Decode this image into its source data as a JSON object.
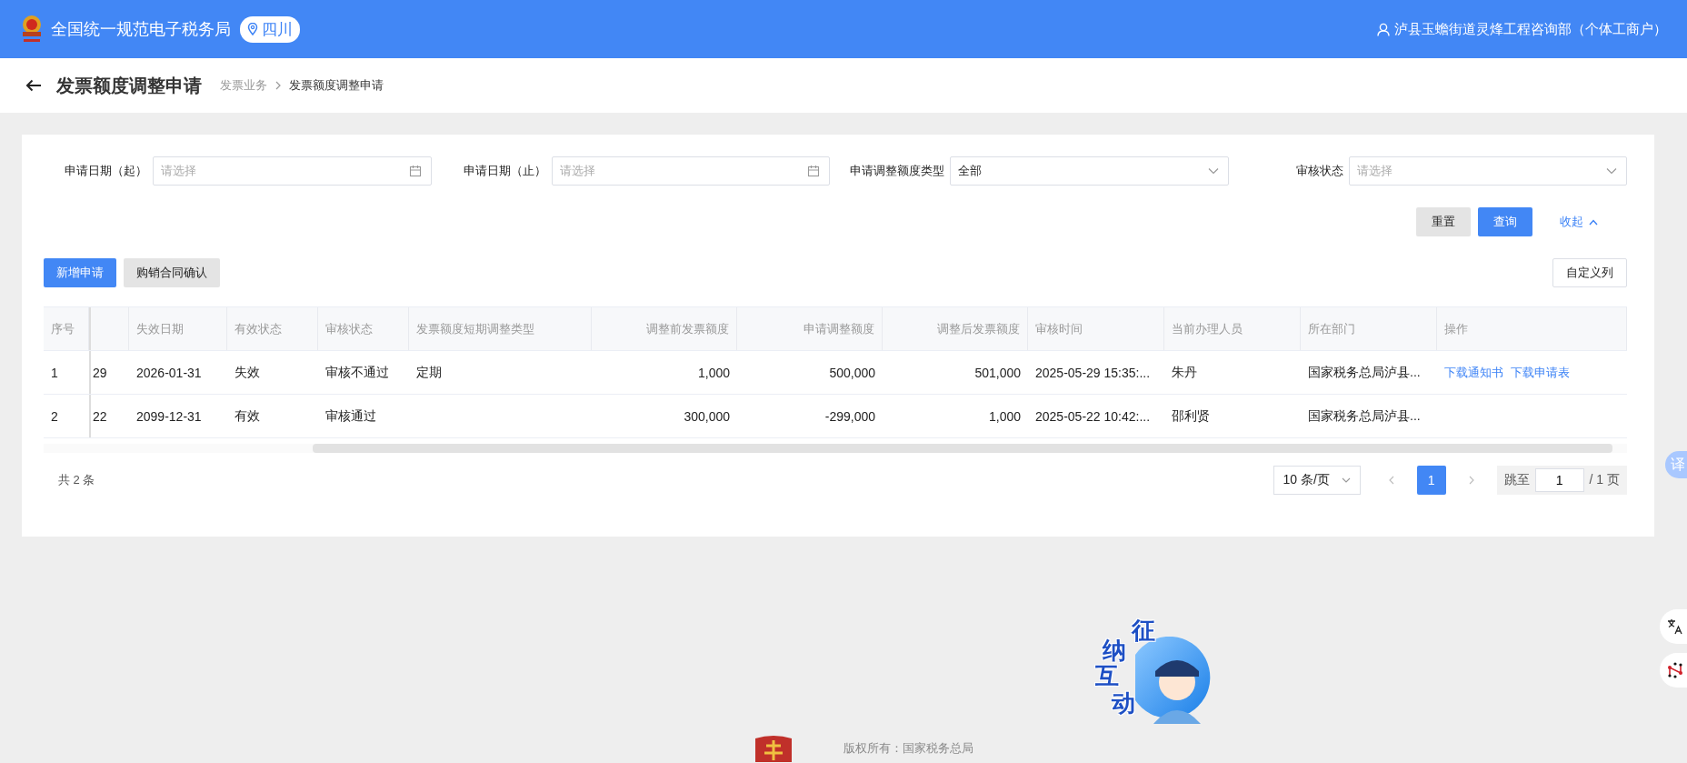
{
  "header": {
    "title": "全国统一规范电子税务局",
    "region": "四川",
    "user": "泸县玉蟾街道灵烽工程咨询部（个体工商户）"
  },
  "page": {
    "title": "发票额度调整申请",
    "breadcrumb": [
      {
        "label": "发票业务",
        "current": false
      },
      {
        "label": "发票额度调整申请",
        "current": true
      }
    ]
  },
  "filters": [
    {
      "label": "申请日期（起）",
      "kind": "date",
      "placeholder": "请选择"
    },
    {
      "label": "申请日期（止）",
      "kind": "date",
      "placeholder": "请选择"
    },
    {
      "label": "申请调整额度类型",
      "kind": "select",
      "value": "全部"
    },
    {
      "label": "审核状态",
      "kind": "select",
      "placeholder": "请选择"
    }
  ],
  "filter_actions": [
    {
      "label": "重置",
      "kind": "default"
    },
    {
      "label": "查询",
      "kind": "primary"
    },
    {
      "label": "收起",
      "kind": "collapse"
    }
  ],
  "toolbar": [
    {
      "label": "新增申请",
      "kind": "primary"
    },
    {
      "label": "购销合同确认",
      "kind": "default"
    }
  ],
  "column_settings": "自定义列",
  "table": {
    "columns": [
      {
        "label": "序号",
        "numeric": false
      },
      {},
      {
        "label": "失效日期",
        "numeric": false
      },
      {
        "label": "有效状态",
        "numeric": false
      },
      {
        "label": "审核状态",
        "numeric": false
      },
      {
        "label": "发票额度短期调整类型",
        "numeric": false
      },
      {
        "label": "调整前发票额度",
        "numeric": true
      },
      {
        "label": "申请调整额度",
        "numeric": true
      },
      {
        "label": "调整后发票额度",
        "numeric": true
      },
      {
        "label": "审核时间",
        "numeric": false
      },
      {
        "label": "当前办理人员",
        "numeric": false
      },
      {
        "label": "所在部门",
        "numeric": false
      },
      {
        "label": "操作",
        "numeric": false
      }
    ],
    "rows": [
      {
        "cells": [
          "1",
          "29",
          "2026-01-31",
          "失效",
          "审核不通过",
          "定期",
          "1,000",
          "500,000",
          "501,000",
          "2025-05-29 15:35:...",
          "朱丹",
          "国家税务总局泸县..."
        ],
        "actions": [
          "下载通知书",
          "下载申请表"
        ]
      },
      {
        "cells": [
          "2",
          "22",
          "2099-12-31",
          "有效",
          "审核通过",
          null,
          "300,000",
          "-299,000",
          "1,000",
          "2025-05-22 10:42:...",
          "邵利贤",
          "国家税务总局泸县..."
        ]
      }
    ]
  },
  "pagination": {
    "total": "共 2 条",
    "page_size": "10 条/页",
    "pages": [
      {
        "label": "1",
        "selected": true
      }
    ],
    "jump_label": "跳至",
    "jump_value": "1",
    "page_count": "/ 1 页"
  },
  "footer": {
    "copyright": "版权所有：国家税务总局"
  },
  "floating": {
    "translate_tab": "译",
    "mascot_chars": [
      "征",
      "纳",
      "互",
      "动"
    ]
  }
}
